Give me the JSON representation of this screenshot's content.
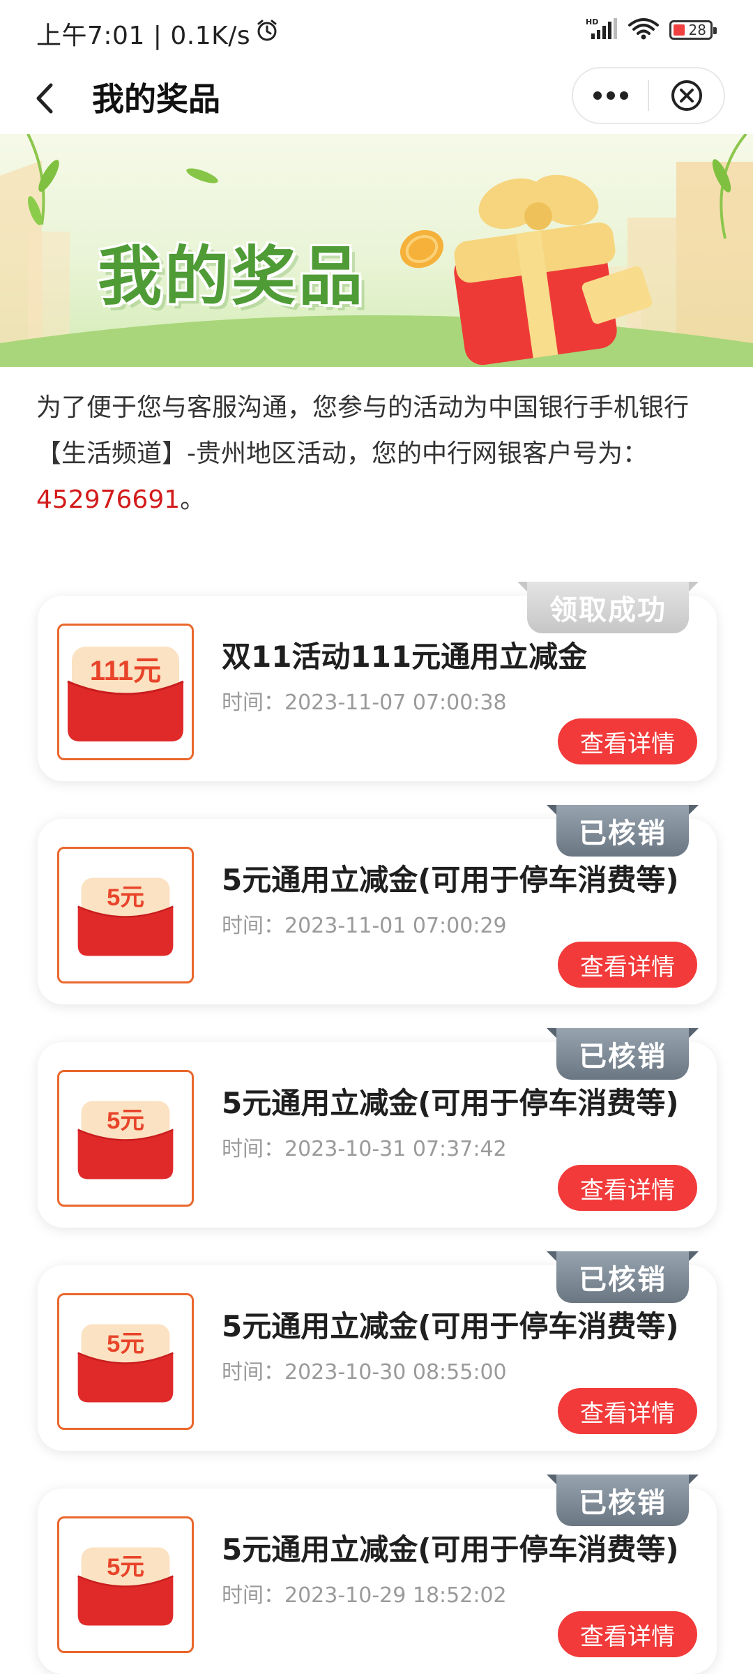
{
  "status_bar": {
    "time_speed": "上午7:01 | 0.1K/s",
    "network_label": "HD",
    "battery": "28"
  },
  "nav": {
    "title": "我的奖品"
  },
  "banner": {
    "title": "我的奖品"
  },
  "info": {
    "text": "为了便于您与客服沟通，您参与的活动为中国银行手机银行【生活频道】-贵州地区活动，您的中行网银客户号为：",
    "account_no": "452976691",
    "suffix": "。"
  },
  "prizes": [
    {
      "badge": "领取成功",
      "status": "success",
      "thumb_label": "111元",
      "name": "双11活动111元通用立减金",
      "time": "时间：2023-11-07 07:00:38",
      "button": "查看详情"
    },
    {
      "badge": "已核销",
      "status": "used",
      "thumb_label": "5元",
      "name": "5元通用立减金(可用于停车消费等)",
      "time": "时间：2023-11-01 07:00:29",
      "button": "查看详情"
    },
    {
      "badge": "已核销",
      "status": "used",
      "thumb_label": "5元",
      "name": "5元通用立减金(可用于停车消费等)",
      "time": "时间：2023-10-31 07:37:42",
      "button": "查看详情"
    },
    {
      "badge": "已核销",
      "status": "used",
      "thumb_label": "5元",
      "name": "5元通用立减金(可用于停车消费等)",
      "time": "时间：2023-10-30 08:55:00",
      "button": "查看详情"
    },
    {
      "badge": "已核销",
      "status": "used",
      "thumb_label": "5元",
      "name": "5元通用立减金(可用于停车消费等)",
      "time": "时间：2023-10-29 18:52:02",
      "button": "查看详情"
    }
  ],
  "colors": {
    "accent_red": "#f23a3a",
    "account_red": "#d31b1b",
    "banner_green": "#4f9b36",
    "thumb_border": "#e9672d"
  }
}
